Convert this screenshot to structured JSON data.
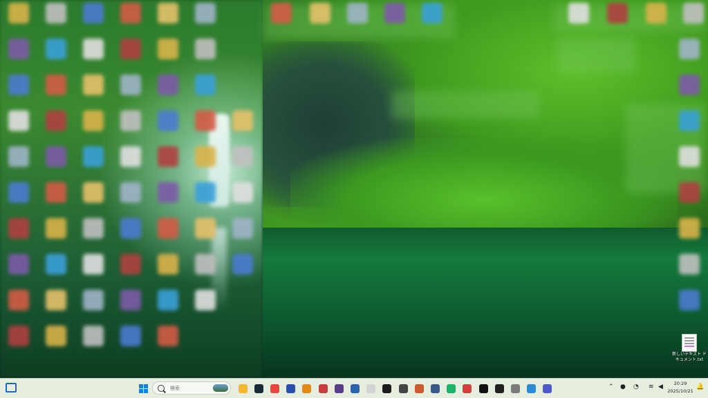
{
  "desktop": {
    "file_icon_label": "新しいテキスト ドキュメント.txt"
  },
  "taskbar": {
    "search_placeholder": "検索",
    "pinned_apps": [
      {
        "icon": "file-explorer-icon",
        "color": "#f2b632"
      },
      {
        "icon": "steam-icon",
        "color": "#1b2838"
      },
      {
        "icon": "chrome-icon",
        "color": "#e8453c"
      },
      {
        "icon": "app-icon-1",
        "color": "#2a4db0"
      },
      {
        "icon": "pencil-icon",
        "color": "#e08a1a"
      },
      {
        "icon": "app-icon-2",
        "color": "#c73c3c"
      },
      {
        "icon": "app-icon-3",
        "color": "#5a3d8a"
      },
      {
        "icon": "notepad-icon",
        "color": "#2c63b0"
      },
      {
        "icon": "app-icon-4",
        "color": "#d3d3d3"
      },
      {
        "icon": "app-icon-5",
        "color": "#1c1c1c"
      },
      {
        "icon": "app-icon-6",
        "color": "#444444"
      },
      {
        "icon": "app-icon-7",
        "color": "#cd5a2f"
      },
      {
        "icon": "calculator-icon",
        "color": "#3a5a8a"
      },
      {
        "icon": "app-icon-8",
        "color": "#1db36b"
      },
      {
        "icon": "app-icon-9",
        "color": "#d63d3d"
      },
      {
        "icon": "app-icon-10",
        "color": "#111111"
      },
      {
        "icon": "app-icon-11",
        "color": "#202020"
      },
      {
        "icon": "app-icon-12",
        "color": "#7a7a7a"
      },
      {
        "icon": "app-icon-13",
        "color": "#2a8bd8"
      },
      {
        "icon": "teams-icon",
        "color": "#5059c9"
      }
    ],
    "clock_time": "20:29",
    "clock_date": "2025/10/21"
  },
  "colors": {
    "taskbar_bg": "#e6eedf",
    "accent": "#1a7fd8"
  }
}
